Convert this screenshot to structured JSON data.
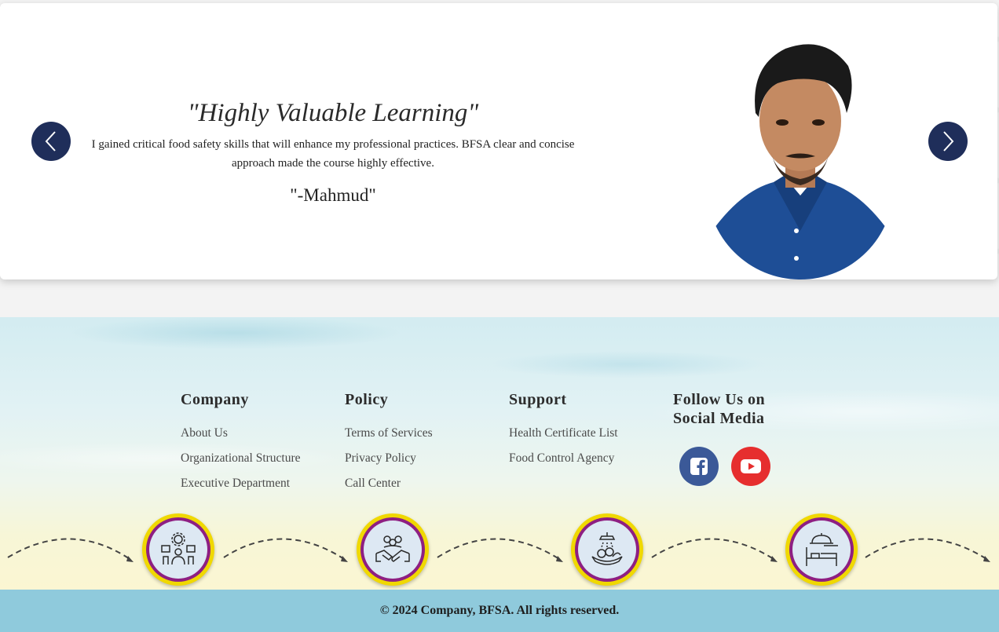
{
  "testimonial": {
    "title": "\"Highly Valuable Learning\"",
    "text": "I gained critical food safety skills that will enhance my professional practices. BFSA clear and concise approach made the course highly effective.",
    "author": "\"-Mahmud\""
  },
  "colors": {
    "nav_button": "#1f2e5a",
    "facebook": "#3b5998",
    "youtube": "#e62e2e",
    "badge_ring": "#f0d800",
    "badge_border": "#8e1f82",
    "copyright_bar": "#8fcadc"
  },
  "footer": {
    "company": {
      "heading": "Company",
      "links": [
        "About Us",
        "Organizational Structure",
        "Executive Department"
      ]
    },
    "policy": {
      "heading": "Policy",
      "links": [
        "Terms of Services",
        "Privacy Policy",
        "Call Center"
      ]
    },
    "support": {
      "heading": "Support",
      "links": [
        "Health Certificate List",
        "Food Control Agency"
      ]
    },
    "social": {
      "heading": "Follow Us on Social Media",
      "icons": [
        "facebook-icon",
        "youtube-icon"
      ]
    },
    "process_icons": [
      "team-management-icon",
      "partnership-handshake-icon",
      "food-washing-icon",
      "hotel-service-icon"
    ]
  },
  "copyright": "© 2024 Company, BFSA. All rights reserved."
}
